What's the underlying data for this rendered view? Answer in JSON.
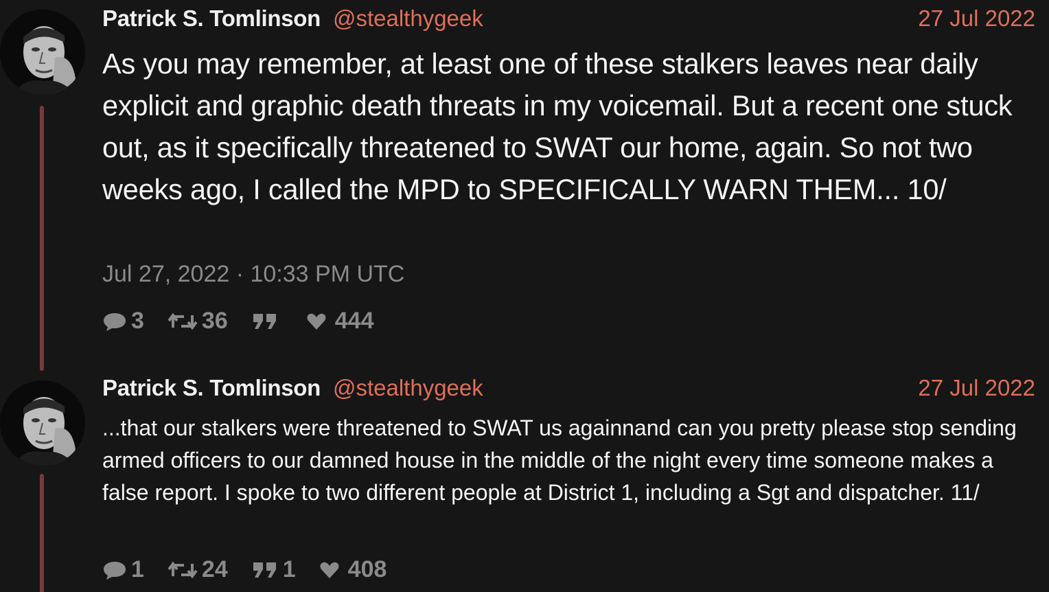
{
  "tweets": [
    {
      "fullname": "Patrick S. Tomlinson",
      "username": "@stealthygeek",
      "date": "27 Jul 2022",
      "content": "As you may remember, at least one of these stalkers leaves near daily explicit and graphic death threats in my voicemail. But a recent one stuck out, as it specifically threatened to SWAT our home, again. So not two weeks ago, I called the MPD to SPECIFICALLY WARN THEM... 10/",
      "published": "Jul 27, 2022 · 10:33 PM UTC",
      "stats": {
        "comments": "3",
        "retweets": "36",
        "quotes": "",
        "likes": "444"
      }
    },
    {
      "fullname": "Patrick S. Tomlinson",
      "username": "@stealthygeek",
      "date": "27 Jul 2022",
      "content": "...that our stalkers were threatened to SWAT us againnand can you pretty please stop sending armed officers to our damned house in the middle of the night every time someone makes a false report. I spoke to two different people at District 1, including a Sgt and dispatcher. 11/",
      "stats": {
        "comments": "1",
        "retweets": "24",
        "quotes": "1",
        "likes": "408"
      }
    }
  ],
  "icons": {
    "comment": "comment-icon",
    "retweet": "retweet-icon",
    "quote": "quote-icon",
    "like": "heart-icon"
  },
  "colors": {
    "background": "#161616",
    "accent": "#e06f5a",
    "thread_line": "#7a3a3a",
    "muted": "#8a8a8a"
  }
}
